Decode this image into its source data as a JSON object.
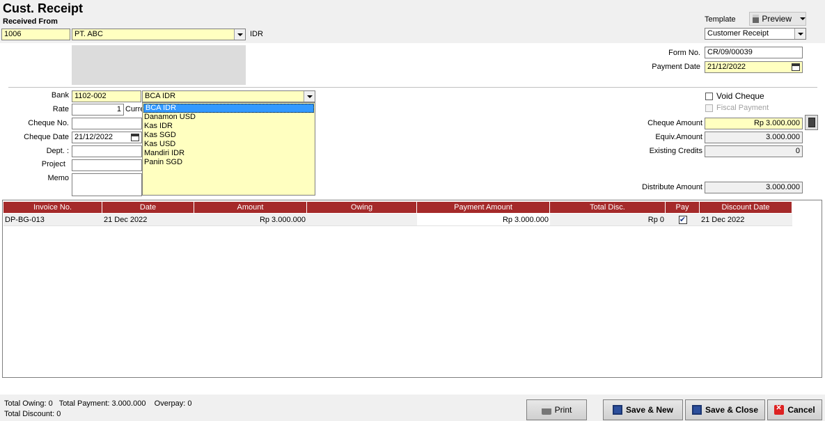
{
  "header": {
    "title": "Cust. Receipt",
    "received_from_label": "Received From",
    "customer_code": "1006",
    "customer_name": "PT. ABC",
    "currency": "IDR",
    "template_label": "Template",
    "preview_label": "Preview",
    "template_value": "Customer Receipt",
    "form_no_label": "Form No.",
    "form_no": "CR/09/00039",
    "payment_date_label": "Payment Date",
    "payment_date": "21/12/2022"
  },
  "bank_section": {
    "bank_label": "Bank",
    "bank_code": "1102-002",
    "bank_name": "BCA IDR",
    "rate_label": "Rate",
    "rate_value": "1",
    "rate_currency_label": "Curre",
    "cheque_no_label": "Cheque No.",
    "cheque_no": "",
    "cheque_date_label": "Cheque Date",
    "cheque_date": "21/12/2022",
    "dept_label": "Dept. :",
    "project_label": "Project",
    "memo_label": "Memo",
    "dropdown_options": [
      "BCA IDR",
      "Danamon USD",
      "Kas IDR",
      "Kas SGD",
      "Kas USD",
      "Mandiri IDR",
      "Panin SGD"
    ]
  },
  "right_panel": {
    "void_cheque_label": "Void Cheque",
    "fiscal_payment_label": "Fiscal Payment",
    "cheque_amount_label": "Cheque Amount",
    "cheque_amount": "Rp 3.000.000",
    "equiv_amount_label": "Equiv.Amount",
    "equiv_amount": "3.000.000",
    "existing_credits_label": "Existing Credits",
    "existing_credits": "0",
    "distribute_amount_label": "Distribute Amount",
    "distribute_amount": "3.000.000"
  },
  "grid": {
    "columns": [
      "Invoice No.",
      "Date",
      "Amount",
      "Owing",
      "Payment Amount",
      "Total Disc.",
      "Pay",
      "Discount Date"
    ],
    "rows": [
      {
        "invoice_no": "DP-BG-013",
        "date": "21 Dec 2022",
        "amount": "Rp 3.000.000",
        "owing": "",
        "payment_amount": "Rp 3.000.000",
        "total_disc": "Rp 0",
        "pay": true,
        "discount_date": "21 Dec 2022"
      }
    ]
  },
  "footer": {
    "total_owing": "Total Owing: 0",
    "total_payment": "Total Payment: 3.000.000",
    "overpay": "Overpay: 0",
    "total_discount": "Total Discount: 0",
    "print_label": "Print",
    "save_new_label": "Save & New",
    "save_close_label": "Save & Close",
    "cancel_label": "Cancel"
  },
  "colors": {
    "grid_header": "#a52a2a",
    "field_yellow": "#ffffc0",
    "selection": "#3399ff",
    "band": "#f0f0f0"
  }
}
